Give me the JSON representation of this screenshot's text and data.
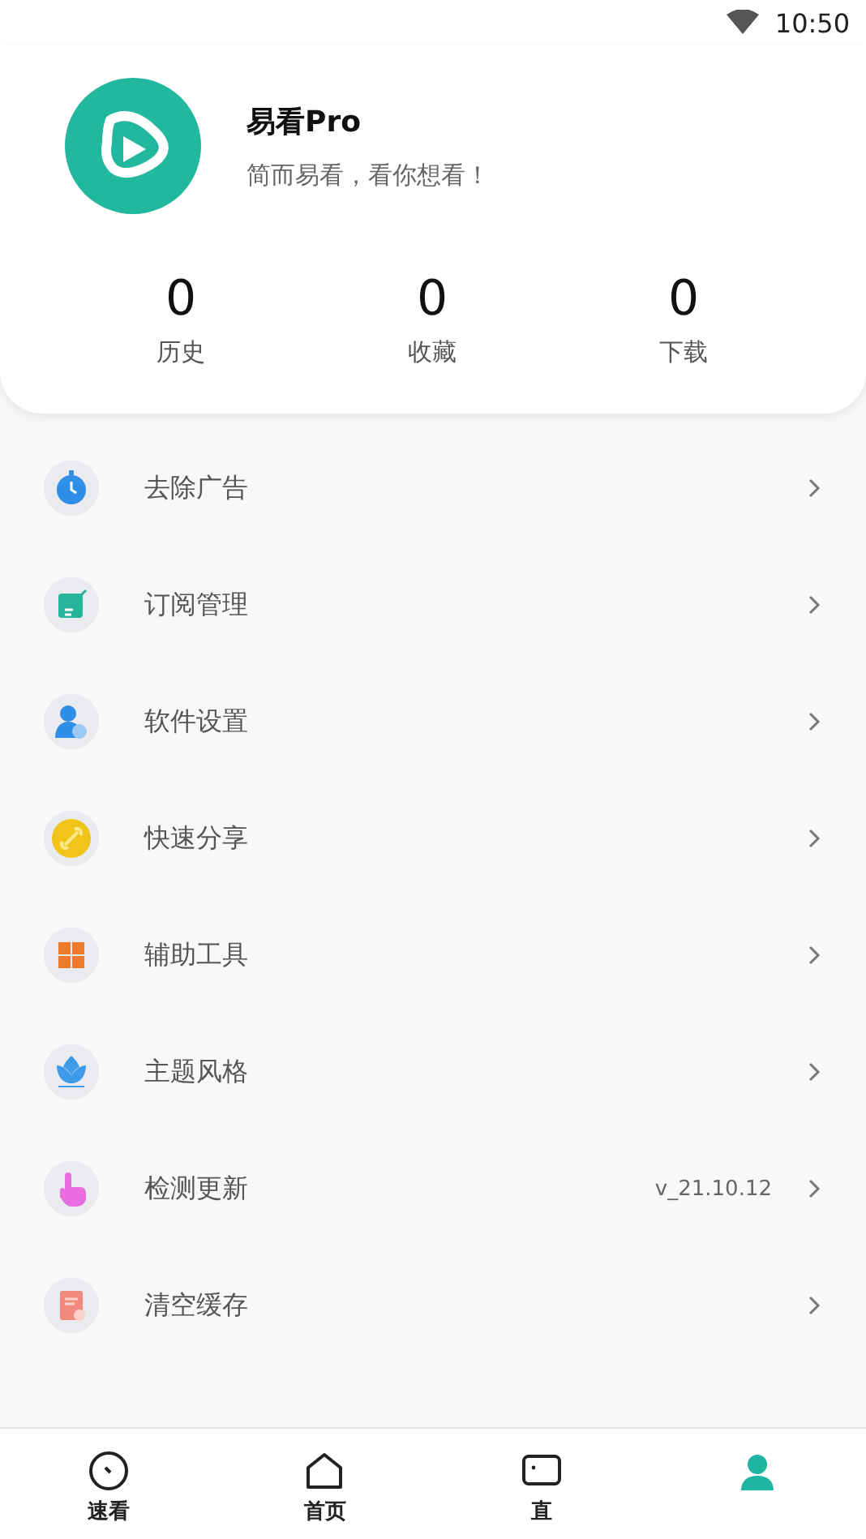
{
  "status_bar": {
    "time": "10:50"
  },
  "profile": {
    "name": "易看Pro",
    "slogan": "简而易看，看你想看！"
  },
  "stats": [
    {
      "value": "0",
      "label": "历史"
    },
    {
      "value": "0",
      "label": "收藏"
    },
    {
      "value": "0",
      "label": "下载"
    }
  ],
  "menu": [
    {
      "label": "去除广告",
      "color": "#2f8ee8"
    },
    {
      "label": "订阅管理",
      "color": "#26b59a"
    },
    {
      "label": "软件设置",
      "color": "#2f8ee8"
    },
    {
      "label": "快速分享",
      "color": "#f0c419"
    },
    {
      "label": "辅助工具",
      "color": "#ee7a30"
    },
    {
      "label": "主题风格",
      "color": "#3d9be9"
    },
    {
      "label": "检测更新",
      "color": "#e86ee0",
      "detail": "v_21.10.12"
    },
    {
      "label": "清空缓存",
      "color": "#f08a7e"
    }
  ],
  "tabs": [
    {
      "label": "速看",
      "selected": false
    },
    {
      "label": "首页",
      "selected": false
    },
    {
      "label": "直",
      "selected": false
    },
    {
      "selected": true
    }
  ]
}
